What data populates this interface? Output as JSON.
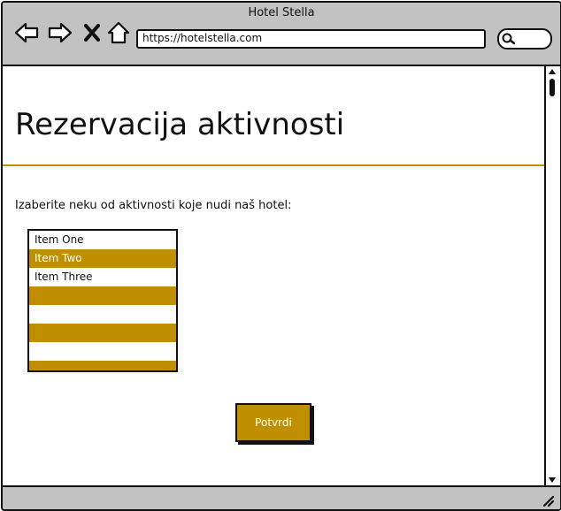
{
  "window": {
    "title": "Hotel Stella"
  },
  "browser": {
    "url": "https://hotelstella.com",
    "nav": [
      "back-icon",
      "forward-icon",
      "close-icon",
      "home-icon"
    ],
    "search_icon": "search-icon"
  },
  "page": {
    "heading": "Rezervacija aktivnosti",
    "prompt": "Izaberite neku od aktivnosti koje nudi naš hotel:",
    "list": {
      "items": [
        "Item One",
        "Item Two",
        "Item Three"
      ],
      "selected_index": 1
    },
    "confirm_button": "Potvrdi"
  },
  "colors": {
    "accent": "#c08f00",
    "chrome": "#c2c2c2",
    "outline": "#111111"
  }
}
